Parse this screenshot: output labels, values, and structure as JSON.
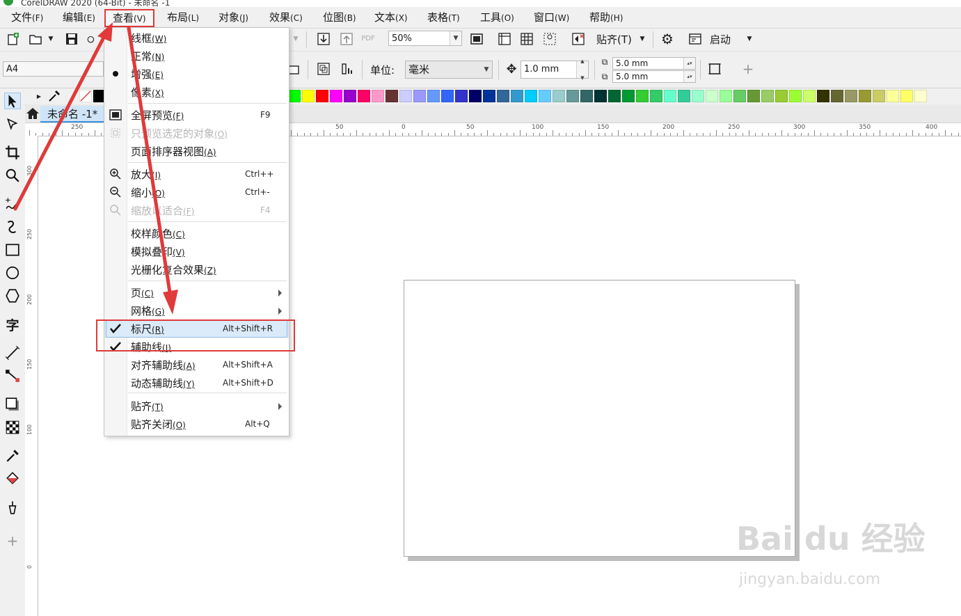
{
  "window": {
    "title": "CorelDRAW 2020 (64-Bit) - 未命名 -1"
  },
  "menubar": [
    {
      "label": "文件",
      "key": "(F)"
    },
    {
      "label": "编辑",
      "key": "(E)"
    },
    {
      "label": "查看",
      "key": "(V)"
    },
    {
      "label": "布局",
      "key": "(L)"
    },
    {
      "label": "对象",
      "key": "(J)"
    },
    {
      "label": "效果",
      "key": "(C)"
    },
    {
      "label": "位图",
      "key": "(B)"
    },
    {
      "label": "文本",
      "key": "(X)"
    },
    {
      "label": "表格",
      "key": "(T)"
    },
    {
      "label": "工具",
      "key": "(O)"
    },
    {
      "label": "窗口",
      "key": "(W)"
    },
    {
      "label": "帮助",
      "key": "(H)"
    }
  ],
  "toolbar": {
    "zoom_value": "50%",
    "snap_label": "贴齐(T)",
    "launch_label": "启动",
    "pdf_label": "PDF"
  },
  "propertybar": {
    "page_size": "A4",
    "units_label": "单位:",
    "units_value": "毫米",
    "nudge_value": "1.0 mm",
    "dup_x": "5.0 mm",
    "dup_y": "5.0 mm",
    "plus": "+"
  },
  "document_tab": {
    "label": "未命名 -1*"
  },
  "ruler": {
    "h_labels": [
      "250",
      "50",
      "0",
      "50",
      "100",
      "150",
      "200",
      "250",
      "300",
      "350",
      "400"
    ],
    "v_labels": [
      "300",
      "250",
      "200",
      "150",
      "100",
      "0"
    ]
  },
  "view_menu": {
    "items": [
      {
        "label": "线框",
        "key": "(W)",
        "shortcut": "",
        "icon": "",
        "state": "normal"
      },
      {
        "label": "正常",
        "key": "(N)",
        "shortcut": "",
        "icon": "",
        "state": "normal"
      },
      {
        "label": "增强",
        "key": "(E)",
        "shortcut": "",
        "icon": "radio-dot-icon",
        "state": "normal"
      },
      {
        "label": "像素",
        "key": "(X)",
        "shortcut": "",
        "icon": "",
        "state": "normal"
      },
      {
        "label": "全屏预览",
        "key": "(F)",
        "shortcut": "F9",
        "icon": "fullscreen-icon",
        "state": "normal"
      },
      {
        "label": "只预览选定的对象",
        "key": "(O)",
        "shortcut": "",
        "icon": "preview-selected-icon",
        "state": "disabled"
      },
      {
        "label": "页面排序器视图",
        "key": "(A)",
        "shortcut": "",
        "icon": "",
        "state": "normal"
      },
      {
        "label": "放大",
        "key": "(I)",
        "shortcut": "Ctrl++",
        "icon": "zoom-in-icon",
        "state": "normal"
      },
      {
        "label": "缩小",
        "key": "(O)",
        "shortcut": "Ctrl+-",
        "icon": "zoom-out-icon",
        "state": "normal"
      },
      {
        "label": "缩放以适合",
        "key": "(F)",
        "shortcut": "F4",
        "icon": "zoom-fit-icon",
        "state": "disabled"
      },
      {
        "label": "校样颜色",
        "key": "(C)",
        "shortcut": "",
        "icon": "",
        "state": "normal"
      },
      {
        "label": "模拟叠印",
        "key": "(V)",
        "shortcut": "",
        "icon": "",
        "state": "normal"
      },
      {
        "label": "光栅化复合效果",
        "key": "(Z)",
        "shortcut": "",
        "icon": "",
        "state": "normal"
      },
      {
        "label": "页",
        "key": "(C)",
        "shortcut": "",
        "icon": "",
        "state": "submenu"
      },
      {
        "label": "网格",
        "key": "(G)",
        "shortcut": "",
        "icon": "",
        "state": "submenu"
      },
      {
        "label": "标尺",
        "key": "(R)",
        "shortcut": "Alt+Shift+R",
        "icon": "check-icon",
        "state": "highlighted"
      },
      {
        "label": "辅助线",
        "key": "(I)",
        "shortcut": "",
        "icon": "check-icon",
        "state": "normal"
      },
      {
        "label": "对齐辅助线",
        "key": "(A)",
        "shortcut": "Alt+Shift+A",
        "icon": "",
        "state": "normal"
      },
      {
        "label": "动态辅助线",
        "key": "(Y)",
        "shortcut": "Alt+Shift+D",
        "icon": "",
        "state": "normal"
      },
      {
        "label": "贴齐",
        "key": "(T)",
        "shortcut": "",
        "icon": "",
        "state": "submenu"
      },
      {
        "label": "贴齐关闭",
        "key": "(O)",
        "shortcut": "Alt+Q",
        "icon": "",
        "state": "normal"
      }
    ]
  },
  "palette": [
    "#00ff00",
    "#ffff00",
    "#ff0000",
    "#ff00ff",
    "#9900cc",
    "#ff0066",
    "#ff99cc",
    "#663333",
    "#ccccff",
    "#9999ff",
    "#6699ff",
    "#3366ff",
    "#3333cc",
    "#000066",
    "#003399",
    "#336699",
    "#3399cc",
    "#00ccff",
    "#66ccff",
    "#99cccc",
    "#669999",
    "#336666",
    "#003333",
    "#006633",
    "#009933",
    "#33cc33",
    "#33cc66",
    "#66ffcc",
    "#33cc99",
    "#99ffcc",
    "#ccffcc",
    "#99ff99",
    "#66cc66",
    "#669933",
    "#99cc66",
    "#99cc33",
    "#99ff33",
    "#ccff66",
    "#333300",
    "#666633",
    "#999966",
    "#999933",
    "#cccc66",
    "#ffff99",
    "#ffff66",
    "#ffffcc"
  ],
  "colors": {
    "accent": "#e03a3a",
    "highlight": "#dbeaf8"
  },
  "watermark": {
    "text": "Bai du 经验",
    "url": "jingyan.baidu.com"
  }
}
